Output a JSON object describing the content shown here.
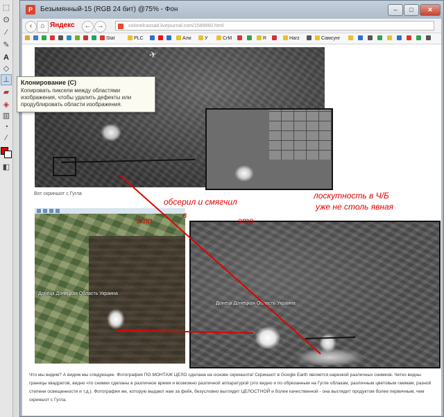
{
  "window": {
    "title": "Безымянный-15 (RGB 24 бит) @75% - Фон",
    "buttons": [
      "–",
      "□",
      "✕"
    ]
  },
  "tooltip": {
    "title": "Клонирование (C)",
    "body": "Копировать пиксели между областями изображения, чтобы удалить дефекты или продублировать области изображения."
  },
  "tools": [
    "selection-icon",
    "lasso-icon",
    "eyedropper-icon",
    "brush-icon",
    "text-icon",
    "shape-icon",
    "clone-stamp-icon",
    "eraser-icon",
    "fill-icon",
    "gradient-icon",
    "dodge-icon",
    "line-icon",
    "crop-icon"
  ],
  "colors": {
    "foreground": "#e00000",
    "background": "#ffffff",
    "annotation": "#e00000"
  },
  "browser": {
    "brand": "Яндекс",
    "url": "colonelcassad.livejournal.com/1589560.html",
    "bookmarks": [
      "Stat",
      "PLC",
      "Али",
      "У",
      "CrM",
      "R",
      "Harz",
      "Самсунг"
    ]
  },
  "page": {
    "caption1": "Вот скриншот с Гугла",
    "ge_label": "Донецк Донецкая Область Украина",
    "bw_label": "Донецк Донецкая Область Украина",
    "annotations": {
      "eto1": "это",
      "v": "в",
      "eto2": "это",
      "mid": "обсерил и смягчил",
      "right_line1": "лоскутность в Ч/Б",
      "right_line2": "уже не столь явная"
    },
    "body_text": "Что мы видим? А видим мы следующее. Фотография ПО МОНТАЖ ЦЕЛО сделана на основе скриншота! Скриншот в Google Earth является нарезкой различных снимков. Четко видны границы квадратов, видно что снимки сделаны в различное время и возможно различной аппаратурой (это видно и по обрезанным на Гугле облакам, различным цветовым гаммам, разной степени освещенности и т.д.). Фотография же, которую выдают нам за фейк, безусловно выглядит ЦЕЛОСТНОЙ и более качественной - она выглядит продуктом более первичным, чем скриншот с Гугла."
  }
}
